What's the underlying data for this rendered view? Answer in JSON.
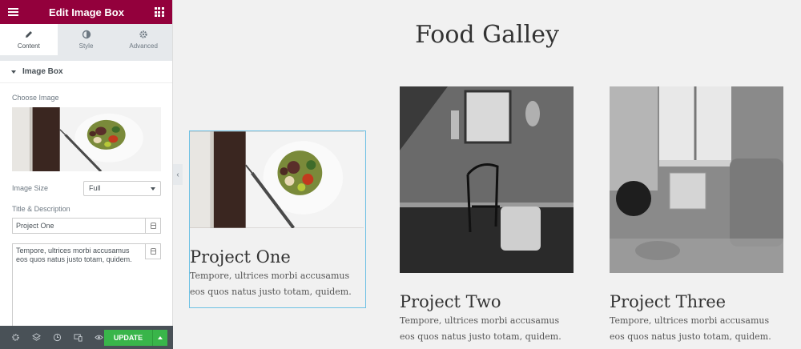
{
  "panel": {
    "title": "Edit Image Box",
    "tabs": [
      {
        "label": "Content",
        "icon": "pencil-icon"
      },
      {
        "label": "Style",
        "icon": "contrast-icon"
      },
      {
        "label": "Advanced",
        "icon": "gear-icon"
      }
    ],
    "section": "Image Box",
    "choose_image_label": "Choose Image",
    "image_size_label": "Image Size",
    "image_size_value": "Full",
    "title_desc_label": "Title & Description",
    "title_value": "Project One",
    "description_value": "Tempore, ultrices morbi accusamus eos quos natus justo totam, quidem.",
    "footer": {
      "icons": [
        "gear-icon",
        "layers-icon",
        "history-icon",
        "responsive-icon",
        "eye-icon"
      ],
      "update_label": "UPDATE"
    },
    "accent_color": "#93003c",
    "update_color": "#39b54a"
  },
  "preview": {
    "page_title": "Food Galley",
    "cards": [
      {
        "title": "Project One",
        "text": "Tempore, ultrices morbi accusamus eos quos natus justo totam, quidem."
      },
      {
        "title": "Project Two",
        "text": "Tempore, ultrices morbi accusamus eos quos natus justo totam, quidem."
      },
      {
        "title": "Project Three",
        "text": "Tempore, ultrices morbi accusamus eos quos natus justo totam, quidem."
      }
    ]
  }
}
